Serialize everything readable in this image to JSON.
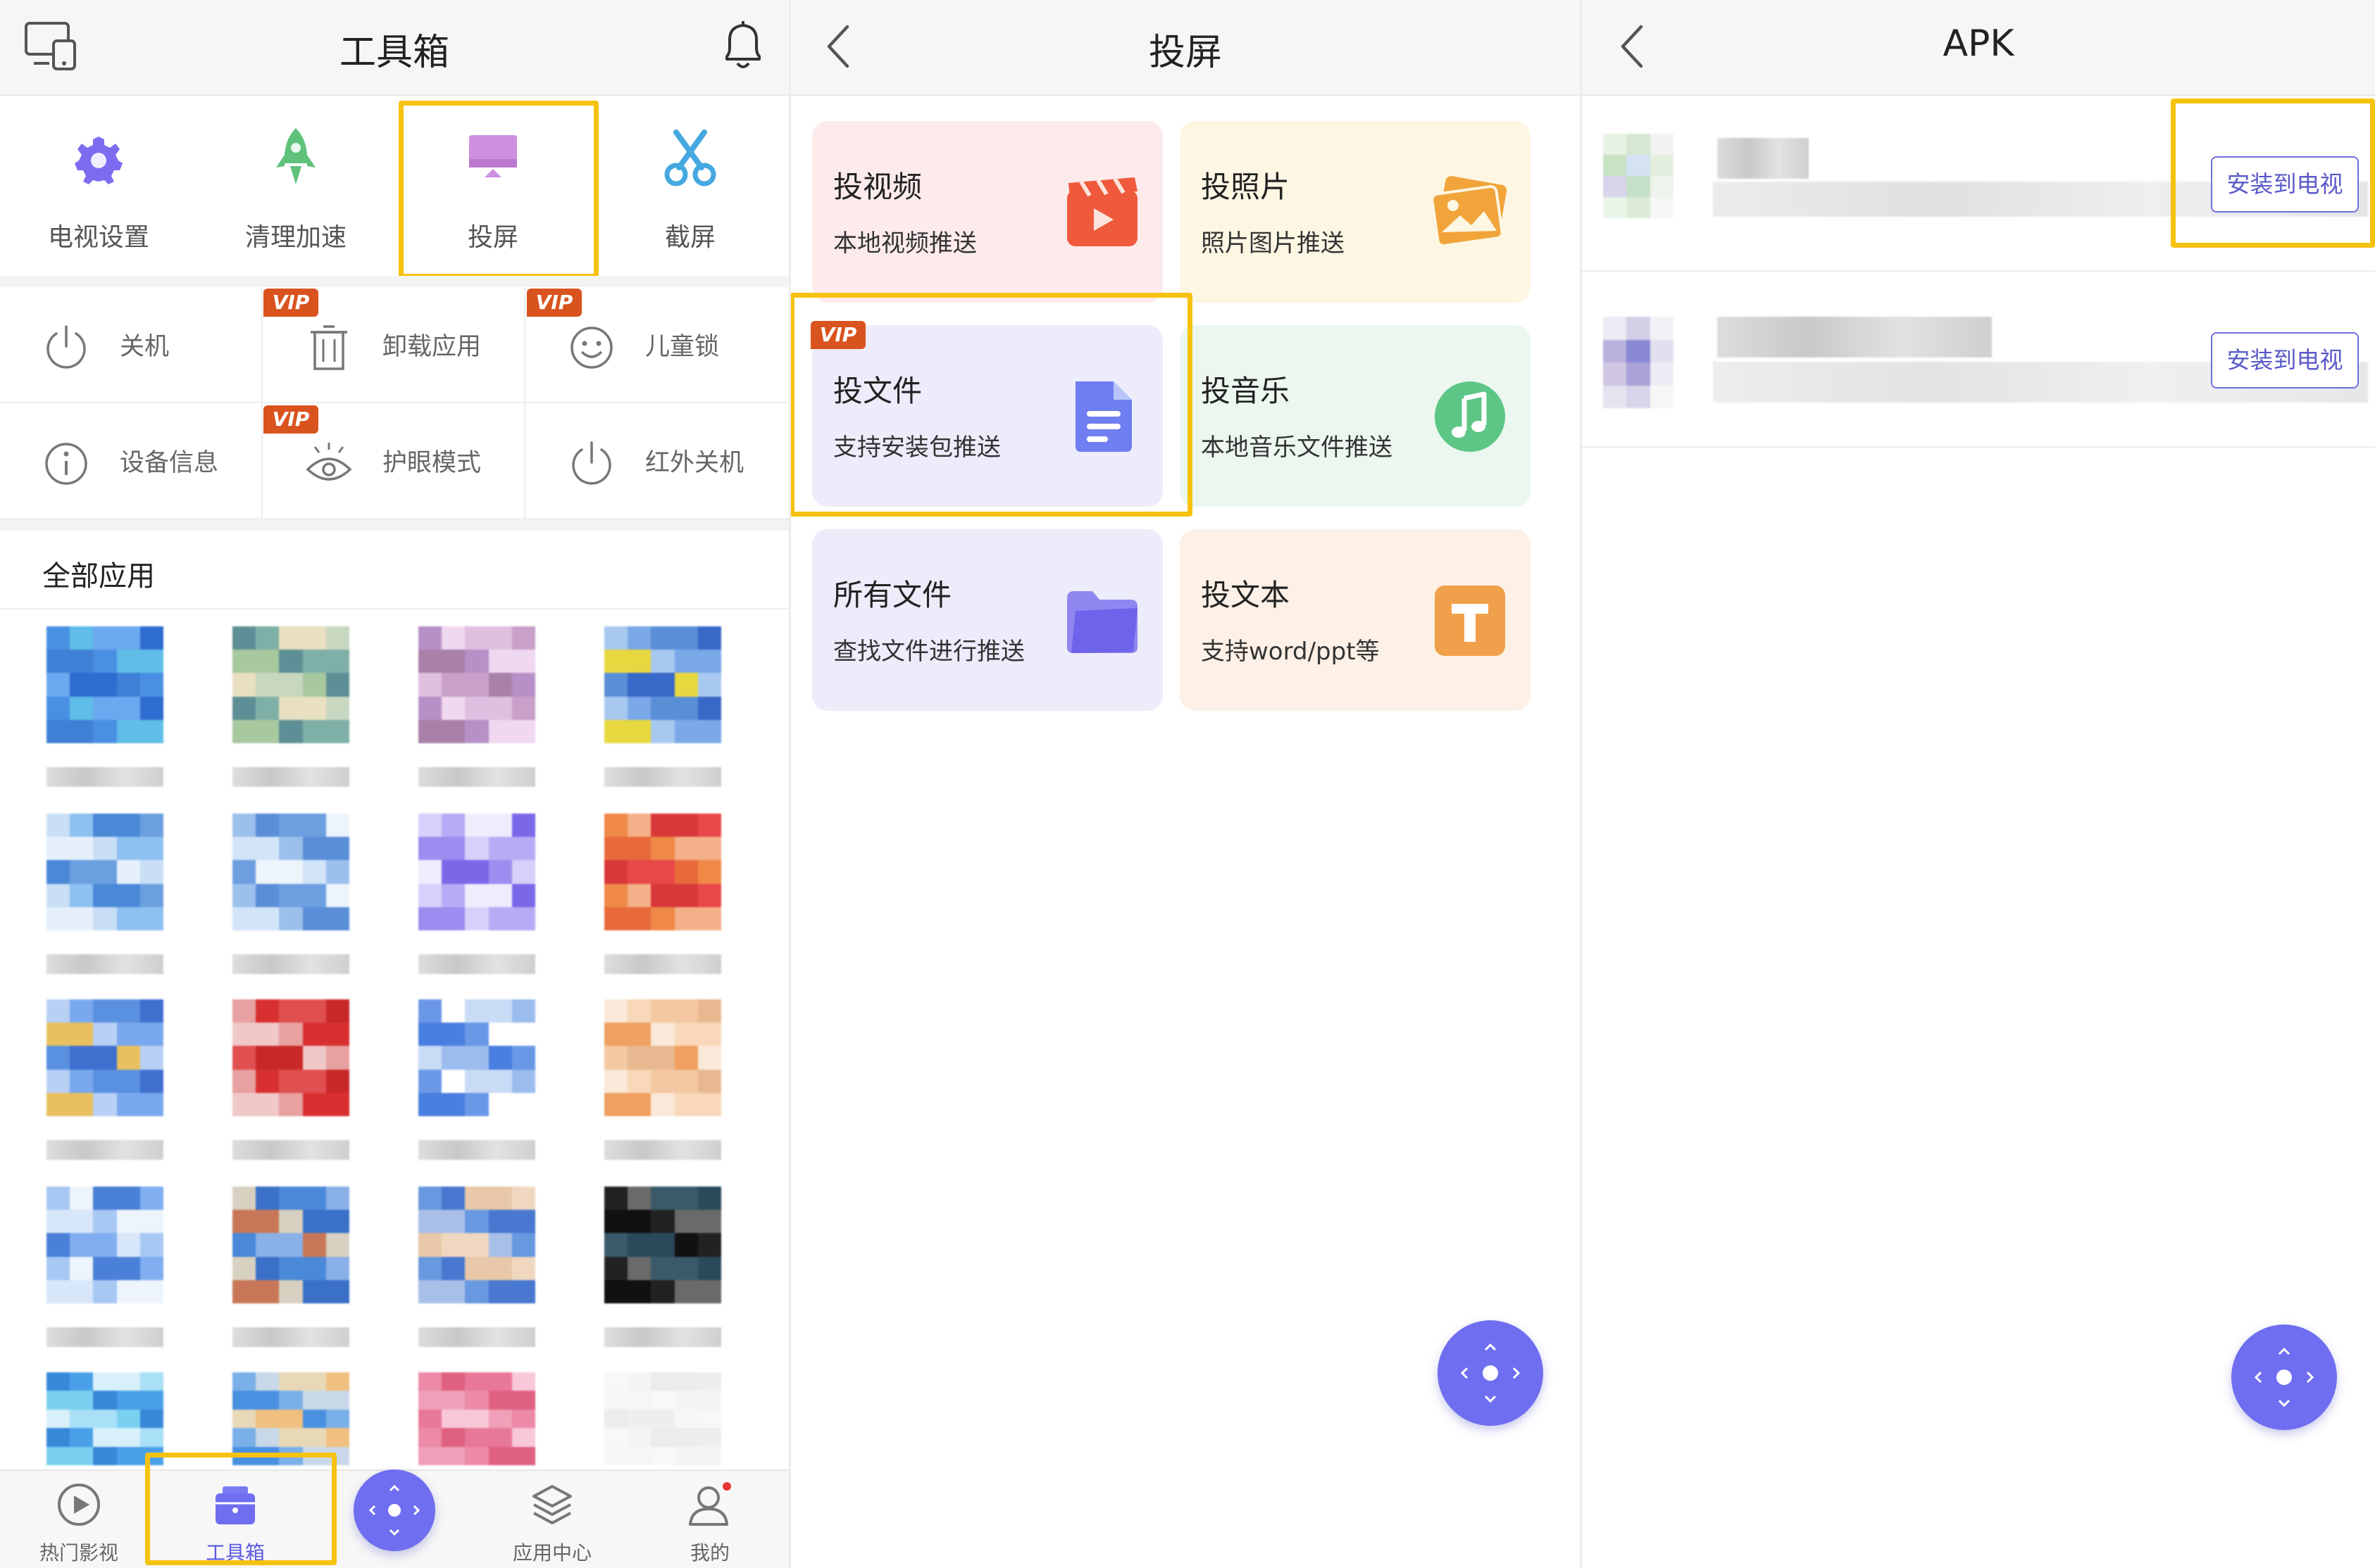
{
  "panel1": {
    "title": "工具箱",
    "tools": [
      {
        "label": "电视设置",
        "icon": "gear-icon"
      },
      {
        "label": "清理加速",
        "icon": "rocket-icon"
      },
      {
        "label": "投屏",
        "icon": "screen-cast-icon"
      },
      {
        "label": "截屏",
        "icon": "scissors-icon"
      }
    ],
    "grid": [
      {
        "label": "关机",
        "icon": "power-icon",
        "vip": false
      },
      {
        "label": "卸载应用",
        "icon": "trash-icon",
        "vip": true
      },
      {
        "label": "儿童锁",
        "icon": "smiley-icon",
        "vip": true
      },
      {
        "label": "设备信息",
        "icon": "info-icon",
        "vip": false
      },
      {
        "label": "护眼模式",
        "icon": "eye-icon",
        "vip": true
      },
      {
        "label": "红外关机",
        "icon": "power-icon",
        "vip": false
      }
    ],
    "vip_badge": "VIP",
    "all_apps_title": "全部应用",
    "tabs": [
      {
        "label": "热门影视",
        "icon": "play-circle-icon"
      },
      {
        "label": "工具箱",
        "icon": "toolbox-icon",
        "active": true
      },
      {
        "label": "",
        "icon": "remote-control-icon"
      },
      {
        "label": "应用中心",
        "icon": "layers-icon"
      },
      {
        "label": "我的",
        "icon": "user-icon"
      }
    ],
    "colors": {
      "accent": "#6f6ef0",
      "highlight": "#f5c20f",
      "vip": "#d9531e"
    }
  },
  "panel2": {
    "title": "投屏",
    "cards": [
      {
        "title": "投视频",
        "subtitle": "本地视频推送",
        "icon": "video-clapper-icon",
        "bg": "#fdebec",
        "icon_color": "#ef5a3d",
        "vip": false
      },
      {
        "title": "投照片",
        "subtitle": "照片图片推送",
        "icon": "photos-icon",
        "bg": "#fdf6e3",
        "icon_color": "#f0a43a",
        "vip": false
      },
      {
        "title": "投文件",
        "subtitle": "支持安装包推送",
        "icon": "document-icon",
        "bg": "#ececfb",
        "icon_color": "#6f7ef0",
        "vip": true
      },
      {
        "title": "投音乐",
        "subtitle": "本地音乐文件推送",
        "icon": "music-note-icon",
        "bg": "#ebf7ef",
        "icon_color": "#5dc686",
        "vip": false
      },
      {
        "title": "所有文件",
        "subtitle": "查找文件进行推送",
        "icon": "folder-icon",
        "bg": "#ececfb",
        "icon_color": "#6e63ea",
        "vip": false
      },
      {
        "title": "投文本",
        "subtitle": "支持word/ppt等",
        "icon": "text-t-icon",
        "bg": "#fdf0e6",
        "icon_color": "#f0a04a",
        "vip": false
      }
    ]
  },
  "panel3": {
    "title": "APK",
    "rows": [
      {
        "button": "安装到电视"
      },
      {
        "button": "安装到电视"
      }
    ]
  }
}
